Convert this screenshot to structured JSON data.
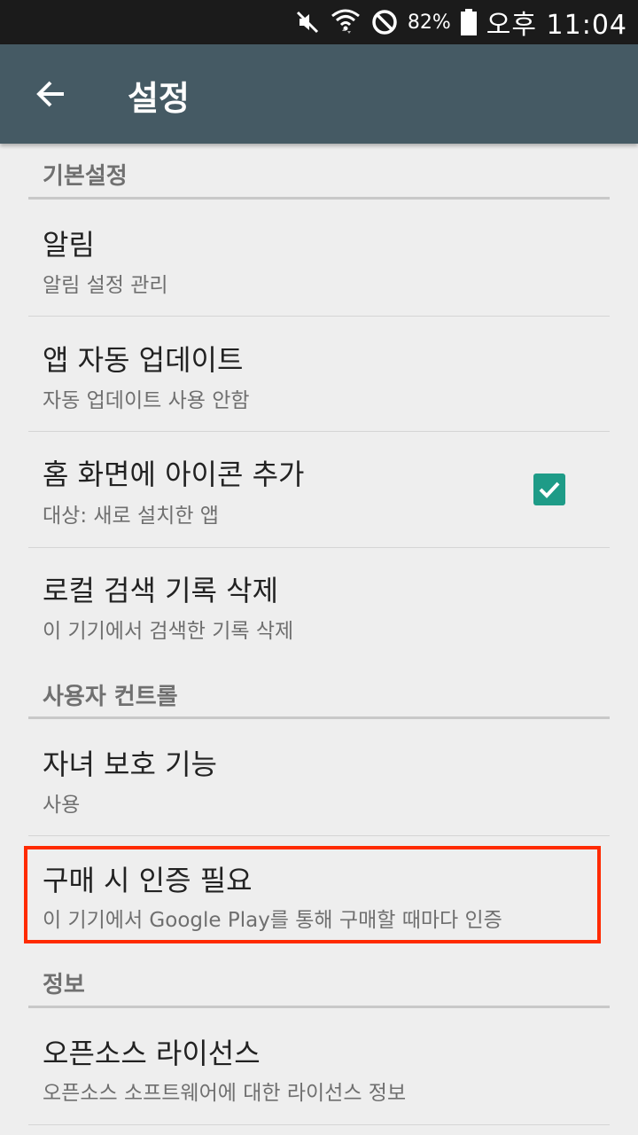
{
  "status_bar": {
    "battery_percent": "82%",
    "time": "오후 11:04",
    "icons": [
      "mute-icon",
      "wifi-icon",
      "block-icon",
      "battery-icon"
    ]
  },
  "app_bar": {
    "title": "설정",
    "back_icon": "arrow-back-icon",
    "color": "#455a64"
  },
  "sections": [
    {
      "header": "기본설정",
      "items": [
        {
          "title": "알림",
          "subtitle": "알림 설정 관리"
        },
        {
          "title": "앱 자동 업데이트",
          "subtitle": "자동 업데이트 사용 안함"
        },
        {
          "title": "홈 화면에 아이콘 추가",
          "subtitle": "대상: 새로 설치한 앱",
          "checked": true
        },
        {
          "title": "로컬 검색 기록 삭제",
          "subtitle": "이 기기에서 검색한 기록 삭제"
        }
      ]
    },
    {
      "header": "사용자 컨트롤",
      "items": [
        {
          "title": "자녀 보호 기능",
          "subtitle": "사용"
        },
        {
          "title": "구매 시 인증 필요",
          "subtitle": "이 기기에서 Google Play를 통해 구매할 때마다 인증",
          "highlighted": true
        }
      ]
    },
    {
      "header": "정보",
      "items": [
        {
          "title": "오픈소스 라이선스",
          "subtitle": "오픈소스 소프트웨어에 대한 라이선스 정보"
        }
      ]
    }
  ],
  "colors": {
    "checkbox": "#1e9b87",
    "highlight": "#ff2a00"
  }
}
